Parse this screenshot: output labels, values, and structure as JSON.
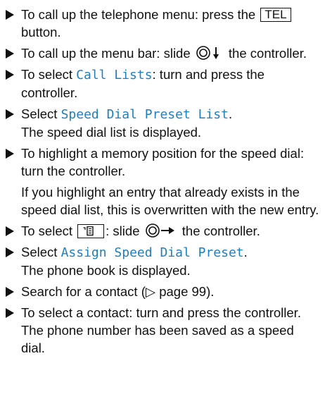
{
  "steps": [
    {
      "before": "To call up the telephone menu: press the ",
      "key": "TEL",
      "after": " button."
    },
    {
      "before": "To call up the menu bar: slide ",
      "after": " the controller.",
      "icon": "controller-slide-down-icon"
    },
    {
      "before": "To select ",
      "code": "Call Lists",
      "after": ": turn and press the controller."
    },
    {
      "before": "Select ",
      "code": "Speed Dial Preset List",
      "after": ".",
      "note": "The speed dial list is displayed."
    },
    {
      "text": "To highlight a memory position for the speed dial: turn the controller.",
      "note": "If you highlight an entry that already exists in the speed dial list, this is overwritten with the new entry."
    },
    {
      "before": "To select ",
      "mid": ": slide ",
      "after": " the controller.",
      "icon1": "phone-book-softkey-icon",
      "icon2": "controller-slide-right-icon"
    },
    {
      "before": "Select ",
      "code": "Assign Speed Dial Preset",
      "after": ".",
      "note": "The phone book is displayed."
    },
    {
      "text": "Search for a contact (▷ page 99)."
    },
    {
      "text": "To select a contact: turn and press the controller.",
      "note": "The phone number has been saved as a speed dial."
    }
  ],
  "colors": {
    "accent": "#1d7fbf",
    "text": "#111111"
  }
}
